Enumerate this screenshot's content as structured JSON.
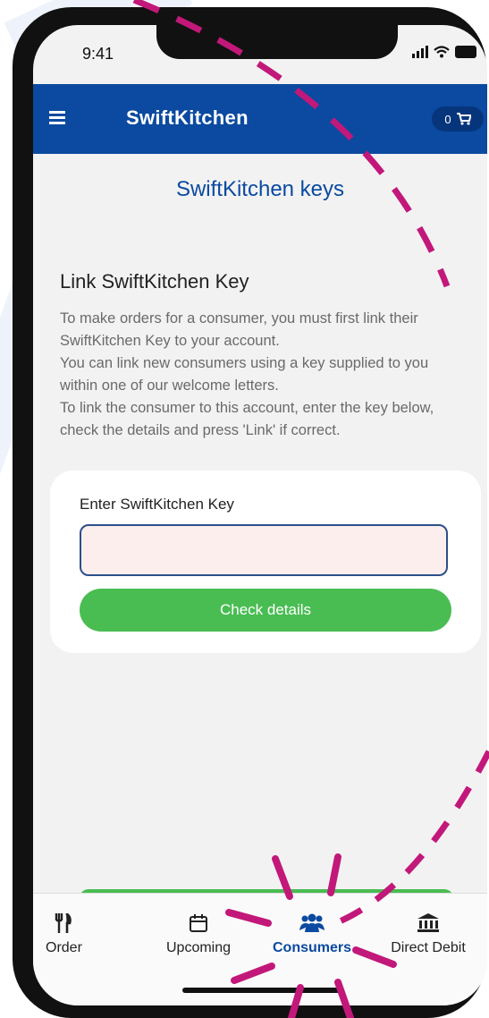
{
  "status": {
    "time": "9:41"
  },
  "appbar": {
    "brand": "SwiftKitchen",
    "cart_count": "0",
    "menu_icon": "menu-icon",
    "cart_icon": "cart-icon"
  },
  "page": {
    "heading": "SwiftKitchen keys",
    "link_title": "Link SwiftKitchen Key",
    "description": [
      "To make orders for a consumer, you must first link their SwiftKitchen Key to your account.",
      "You can link new consumers using a key supplied to you within one of our welcome letters.",
      "To link the consumer to this account, enter the key below, check the details and press 'Link' if correct."
    ]
  },
  "form": {
    "label": "Enter SwiftKitchen Key",
    "value": "",
    "button": "Check details"
  },
  "tabs": [
    {
      "label": "Order",
      "icon": "cutlery-icon"
    },
    {
      "label": "Upcoming",
      "icon": "calendar-icon"
    },
    {
      "label": "Consumers",
      "icon": "users-icon",
      "active": true
    },
    {
      "label": "Direct Debit",
      "icon": "bank-icon"
    }
  ],
  "colors": {
    "primary": "#0b4aa0",
    "button_green": "#49bd52",
    "input_background": "#fdeeee",
    "highlight_magenta": "#c2187a"
  }
}
